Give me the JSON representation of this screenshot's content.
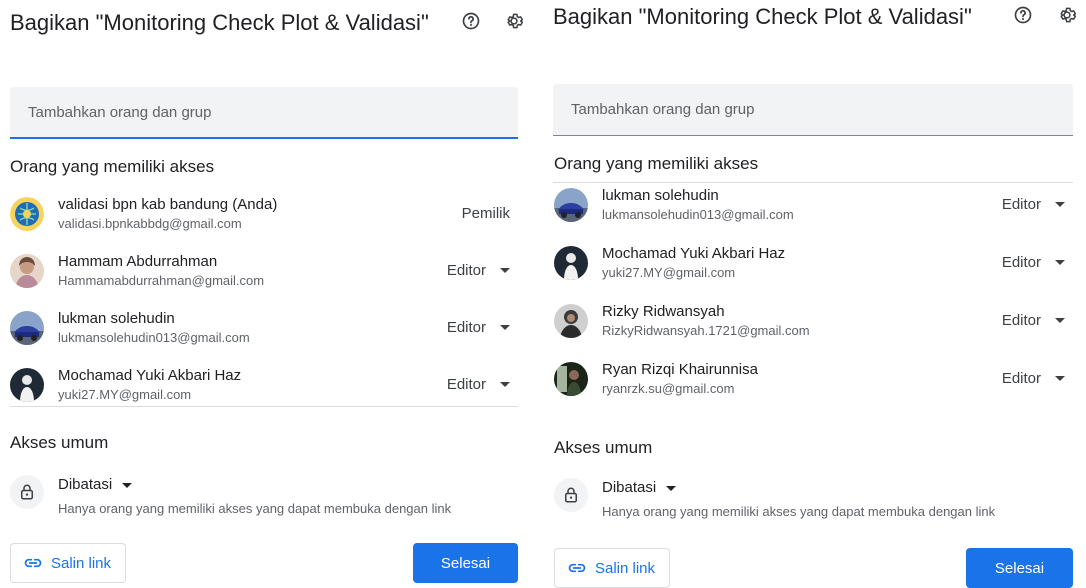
{
  "dialog": {
    "title": "Bagikan \"Monitoring Check Plot & Validasi\"",
    "help_icon": "help-icon",
    "settings_icon": "gear-icon",
    "add_placeholder": "Tambahkan orang dan grup",
    "people_header": "Orang yang memiliki akses",
    "general_header": "Akses umum",
    "access_level": "Dibatasi",
    "access_description": "Hanya orang yang memiliki akses yang dapat membuka dengan link",
    "copy_link_label": "Salin link",
    "done_label": "Selesai"
  },
  "left_people": [
    {
      "name": "validasi bpn kab bandung (Anda)",
      "email": "validasi.bpnkabbdg@gmail.com",
      "role": "Pemilik",
      "avatar": "emblem"
    },
    {
      "name": "Hammam Abdurrahman",
      "email": "Hammamabdurrahman@gmail.com",
      "role": "Editor",
      "avatar": "photo-person"
    },
    {
      "name": "lukman solehudin",
      "email": "lukmansolehudin013@gmail.com",
      "role": "Editor",
      "avatar": "photo-car"
    },
    {
      "name": "Mochamad Yuki Akbari Haz",
      "email": "yuki27.MY@gmail.com",
      "role": "Editor",
      "avatar": "photo-dark"
    }
  ],
  "right_people": [
    {
      "name": "lukman solehudin",
      "email": "lukmansolehudin013@gmail.com",
      "role": "Editor",
      "avatar": "photo-car"
    },
    {
      "name": "Mochamad Yuki Akbari Haz",
      "email": "yuki27.MY@gmail.com",
      "role": "Editor",
      "avatar": "photo-dark"
    },
    {
      "name": "Rizky Ridwansyah",
      "email": "RizkyRidwansyah.1721@gmail.com",
      "role": "Editor",
      "avatar": "photo-person-dark"
    },
    {
      "name": "Ryan Rizqi Khairunnisa",
      "email": "ryanrzk.su@gmail.com",
      "role": "Editor",
      "avatar": "photo-night"
    }
  ],
  "colors": {
    "accent": "#1a73e8",
    "text": "#202124",
    "secondary": "#5f6368",
    "input_bg": "#f1f3f4"
  }
}
